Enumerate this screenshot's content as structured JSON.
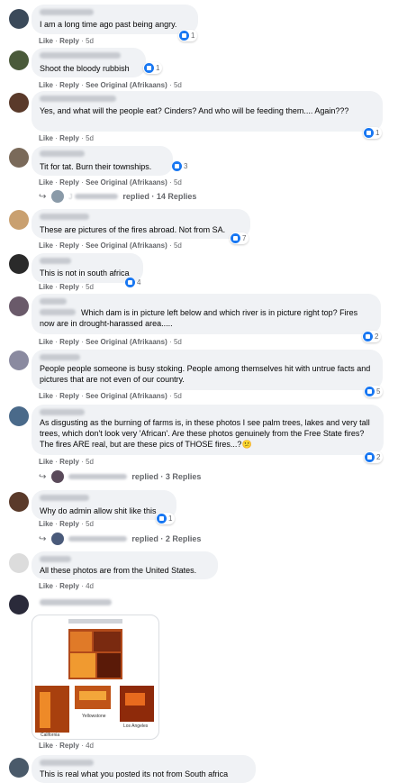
{
  "actions": {
    "like": "Like",
    "reply": "Reply",
    "see_original": "See Original (Afrikaans)",
    "dot": "·"
  },
  "comments": [
    {
      "text": "I am a long time ago past being angry.",
      "time": "5d",
      "reactions": "1"
    },
    {
      "text": "Shoot the bloody rubbish",
      "time": "5d",
      "reactions": "1"
    },
    {
      "text": "Yes, and what will the people eat? Cinders? And who will be feeding them.... Again???",
      "time": "5d",
      "reactions": "1"
    },
    {
      "text": "Tit for tat. Burn their townships.",
      "time": "5d",
      "reactions": "3",
      "replies": "replied · 14 Replies",
      "reply_initial": "J"
    },
    {
      "text": "These are pictures of the fires abroad. Not from SA.",
      "time": "5d",
      "reactions": "7"
    },
    {
      "text": "This is not in south africa",
      "time": "5d",
      "reactions": "4"
    },
    {
      "text": "Which dam is in picture left below and which river is in picture right top? Fires now are in drought-harassed area.....",
      "time": "5d",
      "reactions": "2"
    },
    {
      "text": "People people someone is busy stoking. People among themselves hit with untrue facts and pictures that are not even of our country.",
      "time": "5d",
      "reactions": "5"
    },
    {
      "text": "As disgusting as the burning of farms is, in these photos I see palm trees, lakes and very tall trees, which don't look very 'African'. Are these photos genuinely from the Free State fires? The fires ARE real, but are these pics of THOSE fires...?",
      "emoji": "😕",
      "time": "5d",
      "reactions": "2",
      "replies": "replied · 3 Replies"
    },
    {
      "text": "Why do admin allow shit like this",
      "time": "5d",
      "reactions": "1",
      "replies": "replied · 2 Replies"
    },
    {
      "text": "All these photos are from the United States.",
      "time": "4d"
    },
    {
      "time": "4d",
      "photo_labels": {
        "california": "California",
        "yellowstone": "Yellowstone",
        "los_angeles": "Los Angeles"
      }
    },
    {
      "text": "This is real what you posted its not from South africa"
    }
  ]
}
